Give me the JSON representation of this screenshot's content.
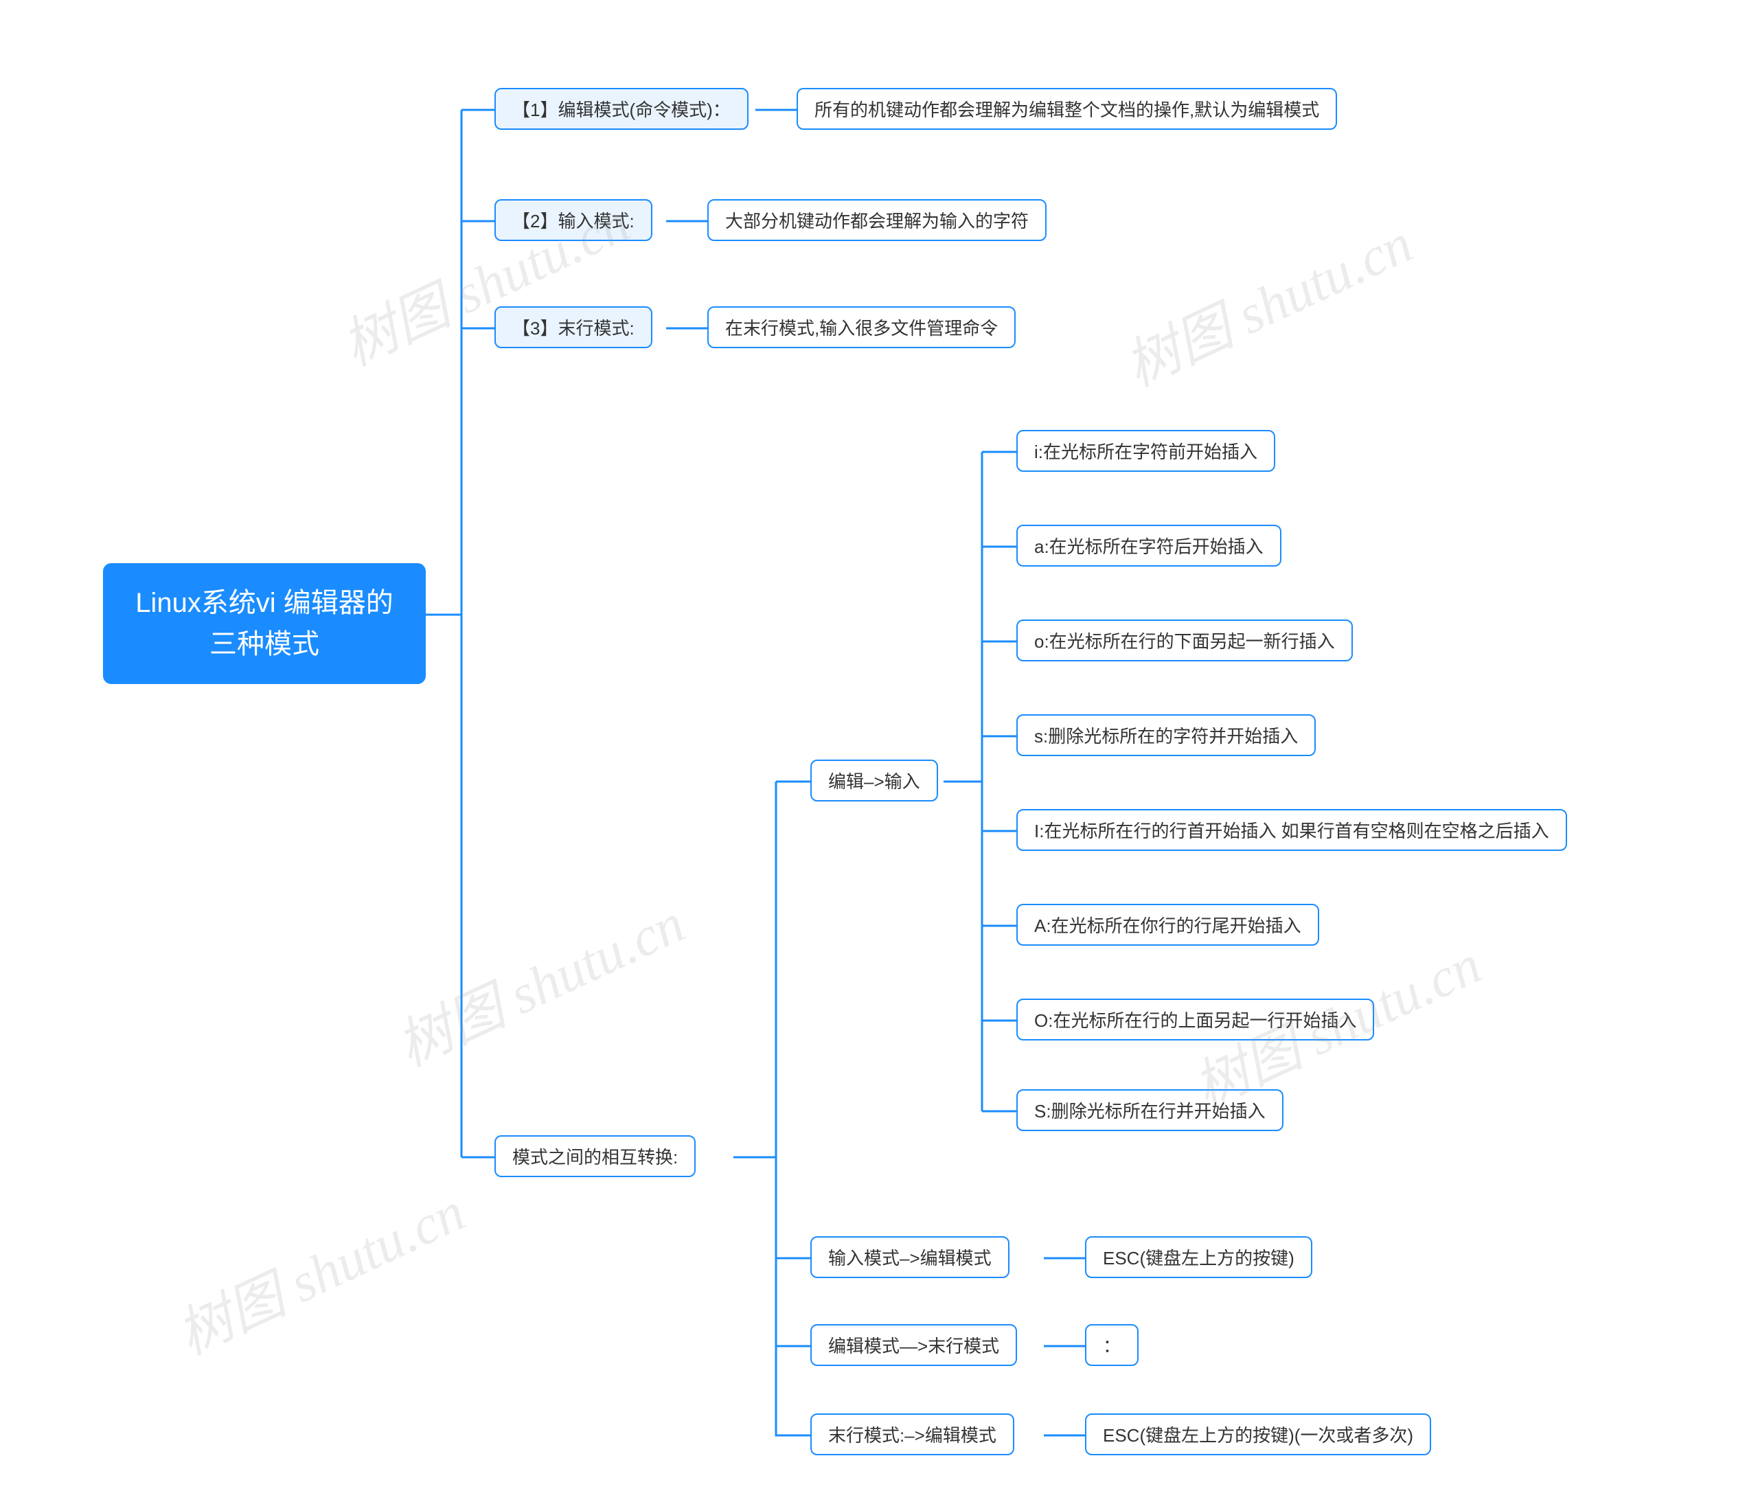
{
  "root": {
    "line1": "Linux系统vi 编辑器的",
    "line2": "三种模式"
  },
  "modes": {
    "m1": {
      "label": "【1】编辑模式(命令模式)：",
      "detail": "所有的机键动作都会理解为编辑整个文档的操作,默认为编辑模式"
    },
    "m2": {
      "label": "【2】输入模式:",
      "detail": "大部分机键动作都会理解为输入的字符"
    },
    "m3": {
      "label": "【3】末行模式:",
      "detail": "在末行模式,输入很多文件管理命令"
    },
    "m4": {
      "label": "模式之间的相互转换:"
    }
  },
  "switch_edit_to_input": {
    "label": "编辑–>输入",
    "items": [
      "i:在光标所在字符前开始插入",
      "a:在光标所在字符后开始插入",
      "o:在光标所在行的下面另起一新行插入",
      "s:删除光标所在的字符并开始插入",
      "I:在光标所在行的行首开始插入 如果行首有空格则在空格之后插入",
      "A:在光标所在你行的行尾开始插入",
      "O:在光标所在行的上面另起一行开始插入",
      "S:删除光标所在行并开始插入"
    ]
  },
  "switch_input_to_edit": {
    "label": "输入模式–>编辑模式",
    "detail": "ESC(键盘左上方的按键)"
  },
  "switch_edit_to_last": {
    "label": "编辑模式—>末行模式",
    "detail": "："
  },
  "switch_last_to_edit": {
    "label": "末行模式:–>编辑模式",
    "detail": "ESC(键盘左上方的按键)(一次或者多次)"
  },
  "watermark": "树图 shutu.cn"
}
